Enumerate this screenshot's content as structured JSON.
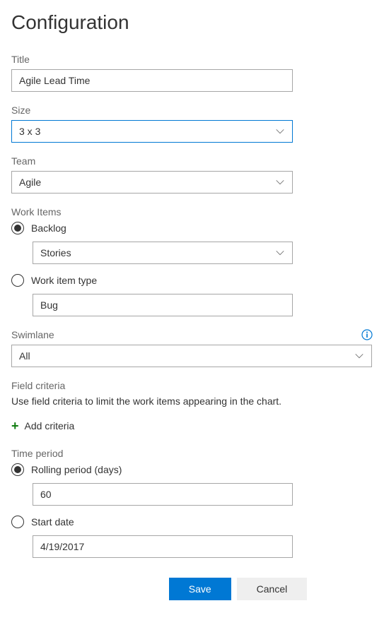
{
  "pageTitle": "Configuration",
  "title": {
    "label": "Title",
    "value": "Agile Lead Time"
  },
  "size": {
    "label": "Size",
    "value": "3 x 3"
  },
  "team": {
    "label": "Team",
    "value": "Agile"
  },
  "workItems": {
    "label": "Work Items",
    "backlog": {
      "label": "Backlog",
      "value": "Stories",
      "selected": true
    },
    "workItemType": {
      "label": "Work item type",
      "value": "Bug",
      "selected": false
    }
  },
  "swimlane": {
    "label": "Swimlane",
    "value": "All"
  },
  "fieldCriteria": {
    "label": "Field criteria",
    "description": "Use field criteria to limit the work items appearing in the chart.",
    "addButton": "Add criteria"
  },
  "timePeriod": {
    "label": "Time period",
    "rolling": {
      "label": "Rolling period (days)",
      "value": "60",
      "selected": true
    },
    "startDate": {
      "label": "Start date",
      "value": "4/19/2017",
      "selected": false
    }
  },
  "buttons": {
    "save": "Save",
    "cancel": "Cancel"
  }
}
